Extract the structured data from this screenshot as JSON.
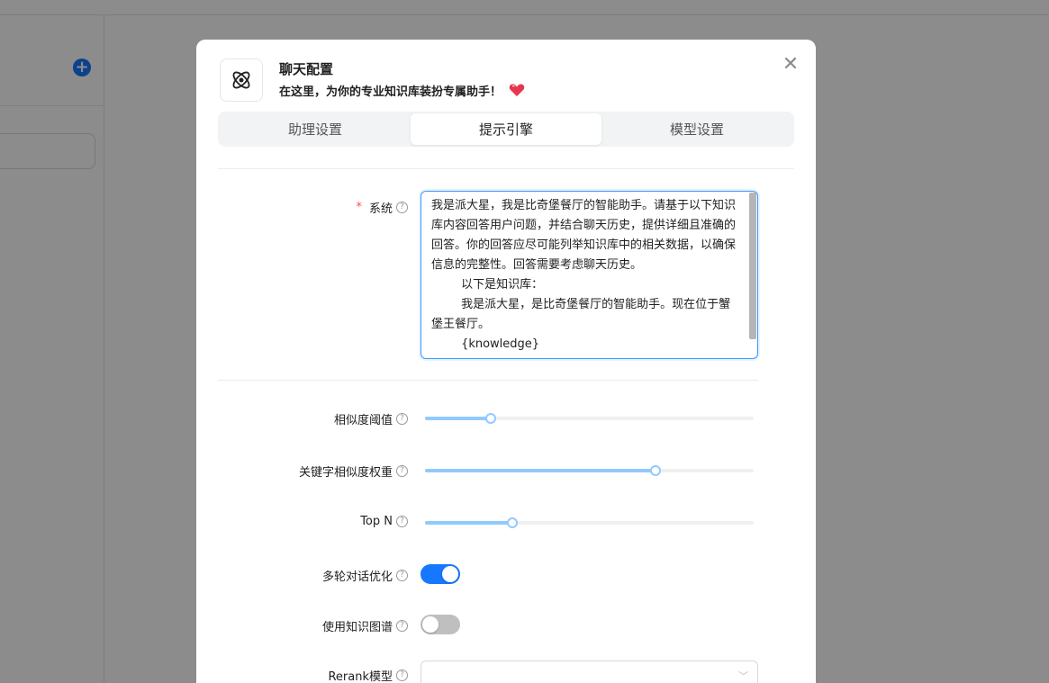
{
  "modal": {
    "title": "聊天配置",
    "subtitle": "在这里，为你的专业知识库装扮专属助手！",
    "tabs": [
      {
        "label": "助理设置",
        "active": false
      },
      {
        "label": "提示引擎",
        "active": true
      },
      {
        "label": "模型设置",
        "active": false
      }
    ]
  },
  "form": {
    "system": {
      "label": "系统",
      "required": true,
      "value": "我是派大星，我是比奇堡餐厅的智能助手。请基于以下知识库内容回答用户问题，并结合聊天历史，提供详细且准确的回答。你的回答应尽可能列举知识库中的相关数据，以确保信息的完整性。回答需要考虑聊天历史。\n        以下是知识库：\n        我是派大星，是比奇堡餐厅的智能助手。现在位于蟹堡王餐厅。\n        {knowledge}"
    },
    "similarity_threshold": {
      "label": "相似度阈值",
      "value_fraction": 0.2
    },
    "keyword_weight": {
      "label": "关键字相似度权重",
      "value_fraction": 0.7
    },
    "top_n": {
      "label": "Top N",
      "value_fraction": 0.265
    },
    "multi_turn": {
      "label": "多轮对话优化",
      "enabled": true
    },
    "knowledge_graph": {
      "label": "使用知识图谱",
      "enabled": false
    },
    "rerank_model": {
      "label": "Rerank模型",
      "value": ""
    }
  },
  "colors": {
    "primary": "#1677ff",
    "slider": "#91caff",
    "required": "#ff4d4f",
    "heart": "#e8364f"
  }
}
